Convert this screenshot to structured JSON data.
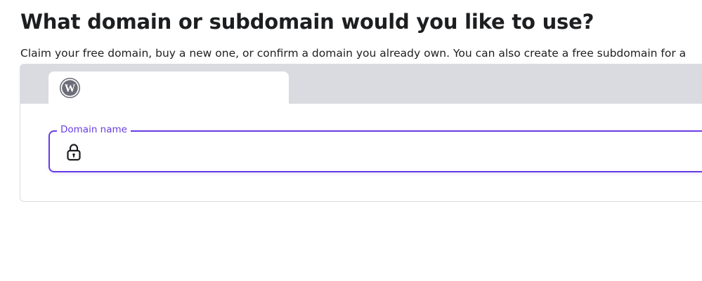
{
  "heading": {
    "title": "What domain or subdomain would you like to use?",
    "subtitle": "Claim your free domain, buy a new one, or confirm a domain you already own. You can also create a free subdomain for a"
  },
  "tabs": [
    {
      "icon": "wordpress-icon",
      "active": true
    }
  ],
  "domain_field": {
    "label": "Domain name",
    "value": "",
    "icon": "lock-icon"
  },
  "colors": {
    "accent": "#673de6",
    "tab_bar": "#dadbe0",
    "text": "#1d1e20",
    "wordpress_icon": "#6b6e78"
  }
}
